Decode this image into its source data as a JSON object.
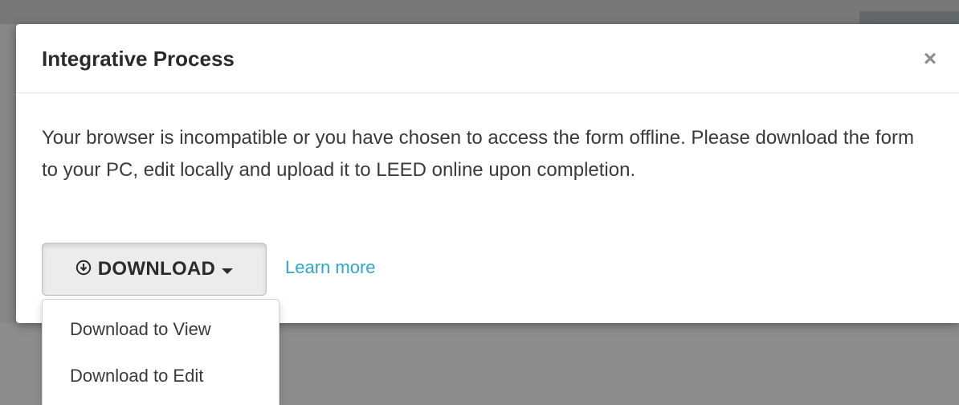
{
  "modal": {
    "title": "Integrative Process",
    "close_symbol": "×",
    "message": "Your browser is incompatible or you have chosen to access the form offline. Please download the form to your PC, edit locally and upload it to LEED online upon completion.",
    "download_button": {
      "label": "DOWNLOAD",
      "icon": "download-circle-icon",
      "caret_icon": "caret-down-icon"
    },
    "learn_more_label": "Learn more"
  },
  "dropdown": {
    "items": [
      {
        "label": "Download to View"
      },
      {
        "label": "Download to Edit"
      }
    ]
  },
  "colors": {
    "link": "#2aa7c9",
    "title_text": "#2b2b2b",
    "body_text": "#3a3a3a",
    "button_bg": "#ececec"
  }
}
